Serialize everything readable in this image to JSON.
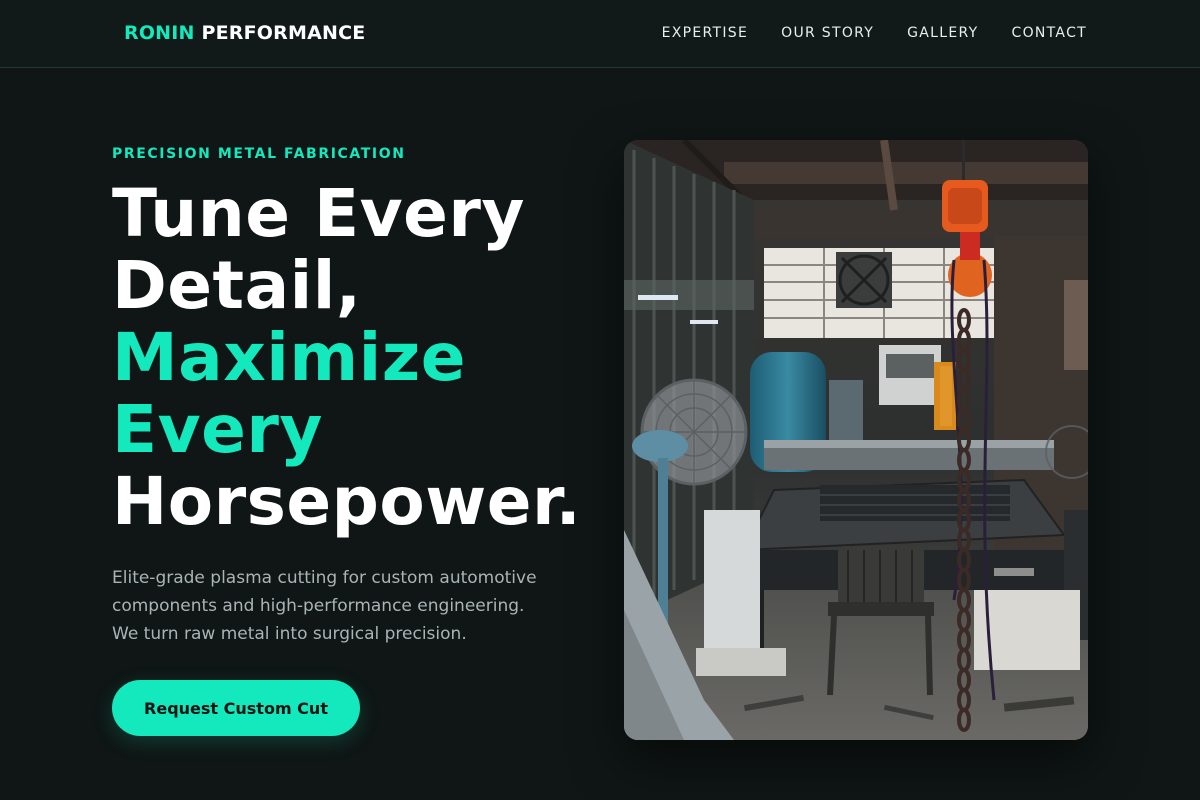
{
  "nav": {
    "brand_accent": "RONIN",
    "brand_rest": "PERFORMANCE",
    "links": [
      "EXPERTISE",
      "OUR STORY",
      "GALLERY",
      "CONTACT"
    ]
  },
  "hero": {
    "eyebrow": "PRECISION METAL FABRICATION",
    "headline": {
      "line1": "Tune Every",
      "line2": "Detail,",
      "line3": "Maximize",
      "line4": "Every",
      "line5": "Horsepower."
    },
    "description": {
      "line1": "Elite-grade plasma cutting for custom automotive",
      "line2": "components and high-performance engineering.",
      "line3": "We turn raw metal into surgical precision."
    },
    "cta_label": "Request Custom Cut",
    "image_alt": "Industrial plasma cutting workshop interior"
  },
  "colors": {
    "accent": "#14e8bd",
    "background": "#0f1615",
    "text": "#ffffff",
    "muted": "#aab4b4"
  }
}
